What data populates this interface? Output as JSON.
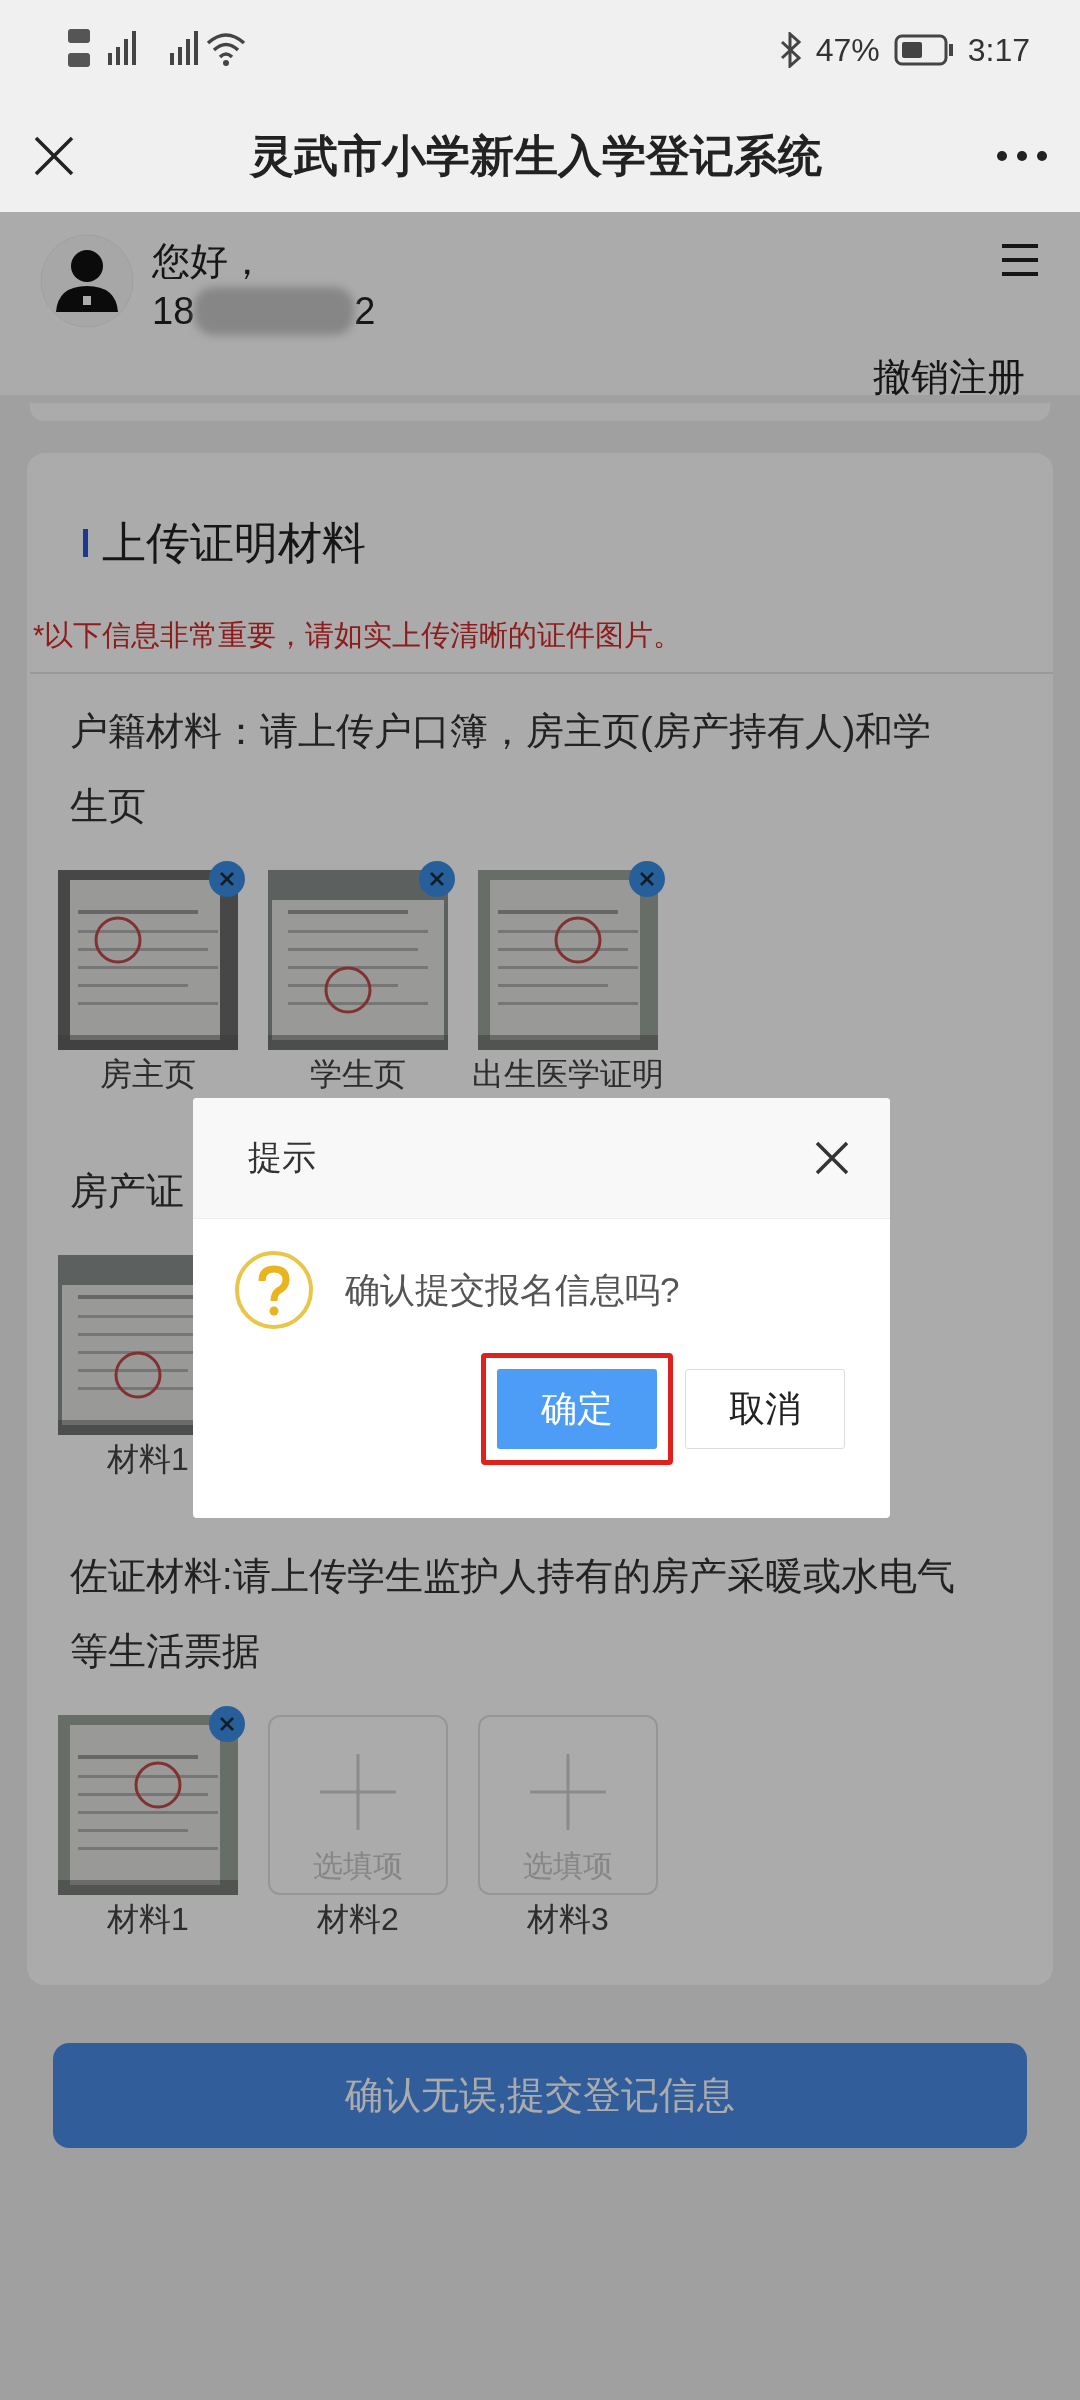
{
  "status_bar": {
    "battery": "47%",
    "time": "3:17"
  },
  "nav": {
    "title": "灵武市小学新生入学登记系统"
  },
  "user": {
    "greeting": "您好，",
    "phone_start": "18",
    "phone_end": "2",
    "action": "撤销注册"
  },
  "card": {
    "title": "上传证明材料",
    "notice": "*以下信息非常重要，请如实上传清晰的证件图片。",
    "sections": [
      {
        "label": "户籍材料：请上传户口簿，房主页(房产持有人)和学生页",
        "slots": [
          {
            "caption": "房主页"
          },
          {
            "caption": "学生页"
          },
          {
            "caption": "出生医学证明"
          }
        ]
      },
      {
        "label": "房产证",
        "slots": [
          {
            "caption": "材料1"
          }
        ]
      },
      {
        "label": "佐证材料:请上传学生监护人持有的房产采暖或水电气等生活票据",
        "slots": [
          {
            "caption": "材料1"
          },
          {
            "kind": "empty",
            "placeholder": "选填项",
            "caption": "材料2"
          },
          {
            "kind": "empty",
            "placeholder": "选填项",
            "caption": "材料3"
          }
        ]
      }
    ]
  },
  "submit": "确认无误,提交登记信息",
  "dialog": {
    "title": "提示",
    "message": "确认提交报名信息吗?",
    "buttons": [
      {
        "label": "确定",
        "kind": "primary",
        "highlighted": true
      },
      {
        "label": "取消",
        "kind": "default",
        "highlighted": false
      }
    ]
  }
}
